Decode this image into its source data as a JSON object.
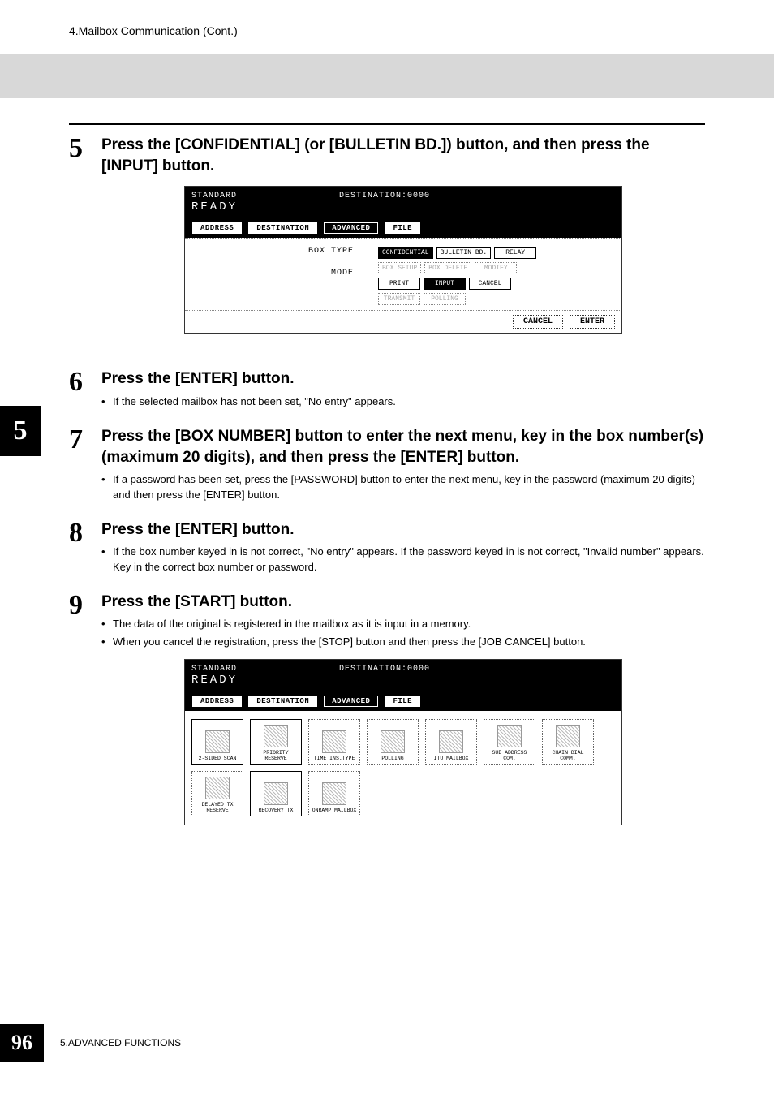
{
  "header": {
    "breadcrumb": "4.Mailbox Communication (Cont.)"
  },
  "side_tab": "5",
  "steps": [
    {
      "num": "5",
      "heading": "Press the [CONFIDENTIAL] (or [BULLETIN BD.]) button, and then press the [INPUT] button.",
      "bullets": []
    },
    {
      "num": "6",
      "heading": "Press the [ENTER] button.",
      "bullets": [
        "If the selected mailbox has not been set, \"No entry\" appears."
      ]
    },
    {
      "num": "7",
      "heading": "Press the [BOX NUMBER] button to enter the next menu, key in the box number(s) (maximum 20 digits), and then press the [ENTER] button.",
      "bullets": [
        "If a password has been set, press the [PASSWORD] button to enter the next menu, key in the password (maximum 20 digits) and then press the [ENTER] button."
      ]
    },
    {
      "num": "8",
      "heading": "Press the [ENTER] button.",
      "bullets": [
        "If the box number keyed in is not correct, \"No entry\" appears. If the password keyed in is not correct, \"Invalid number\" appears. Key in the correct box number or password."
      ]
    },
    {
      "num": "9",
      "heading": "Press the [START] button.",
      "bullets": [
        "The data of the original is registered in the mailbox as it is input in a memory.",
        "When you cancel the registration, press the [STOP] button and then press the [JOB CANCEL] button."
      ]
    }
  ],
  "screen1": {
    "status_standard": "STANDARD",
    "status_ready": "READY",
    "destination": "DESTINATION:0000",
    "tabs": {
      "address": "ADDRESS",
      "destination": "DESTINATION",
      "advanced": "ADVANCED",
      "file": "FILE"
    },
    "labels": {
      "box_type": "BOX TYPE",
      "mode": "MODE"
    },
    "buttons": {
      "confidential": "CONFIDENTIAL",
      "bulletin": "BULLETIN BD.",
      "relay": "RELAY",
      "box_setup": "BOX SETUP",
      "box_delete": "BOX DELETE",
      "modify": "MODIFY",
      "print": "PRINT",
      "input": "INPUT",
      "cancel": "CANCEL",
      "transmit": "TRANSMIT",
      "polling": "POLLING"
    },
    "footer": {
      "cancel": "CANCEL",
      "enter": "ENTER"
    }
  },
  "screen2": {
    "status_standard": "STANDARD",
    "status_ready": "READY",
    "destination": "DESTINATION:0000",
    "tabs": {
      "address": "ADDRESS",
      "destination": "DESTINATION",
      "advanced": "ADVANCED",
      "file": "FILE"
    },
    "items": {
      "two_sided": "2-SIDED SCAN",
      "priority": "PRIORITY RESERVE",
      "time_ins_type": "TIME INS.TYPE",
      "polling": "POLLING",
      "itu_mailbox": "ITU MAILBOX",
      "sub_address": "SUB ADDRESS COM.",
      "chain_dial": "CHAIN DIAL COMM.",
      "delayed_tx": "DELAYED TX RESERVE",
      "recovery_tx": "RECOVERY TX",
      "onramp": "ONRAMP MAILBOX"
    }
  },
  "footer": {
    "page": "96",
    "text": "5.ADVANCED FUNCTIONS"
  }
}
